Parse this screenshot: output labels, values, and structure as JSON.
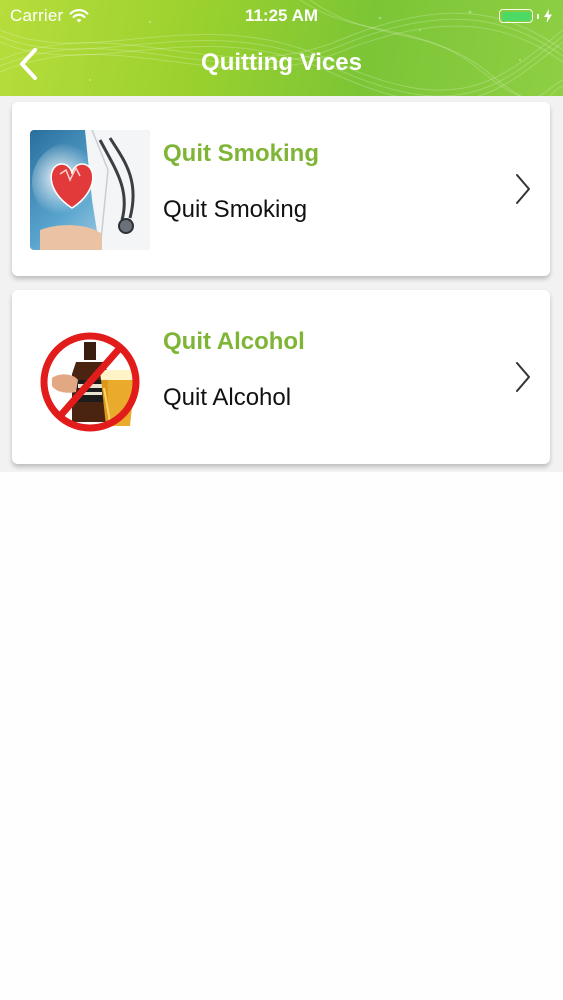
{
  "status_bar": {
    "carrier": "Carrier",
    "time": "11:25 AM",
    "wifi_icon": "wifi-icon",
    "battery_icon": "battery-icon",
    "charging_icon": "bolt-icon"
  },
  "nav": {
    "title": "Quitting Vices",
    "back_icon": "chevron-left-icon"
  },
  "items": [
    {
      "title": "Quit Smoking",
      "subtitle": "Quit Smoking",
      "image": "heart-health-image",
      "chevron_icon": "chevron-right-icon"
    },
    {
      "title": "Quit Alcohol",
      "subtitle": "Quit Alcohol",
      "image": "no-alcohol-image",
      "chevron_icon": "chevron-right-icon"
    }
  ],
  "colors": {
    "header_green": "#8ecf43",
    "title_green": "#7fb536",
    "battery_green": "#4cd964"
  }
}
